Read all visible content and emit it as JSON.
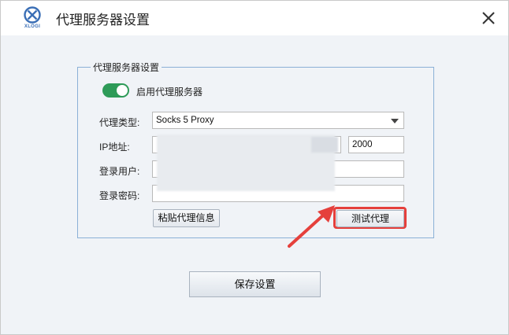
{
  "window": {
    "logo_text": "XLOGI",
    "title": "代理服务器设置",
    "close_icon": "close-icon"
  },
  "proxy_group": {
    "legend": "代理服务器设置",
    "enable_label": "启用代理服务器",
    "enabled": true,
    "type_label": "代理类型:",
    "type_value": "Socks 5 Proxy",
    "ip_label": "IP地址:",
    "ip_value": "",
    "port_value": "2000",
    "user_label": "登录用户:",
    "user_value": "",
    "password_label": "登录密码:",
    "password_value": "",
    "paste_button": "粘贴代理信息",
    "test_button": "测试代理"
  },
  "save_button": "保存设置",
  "colors": {
    "toggle_on": "#2e9b58",
    "highlight": "#e5403c",
    "group_border": "#8bb0d6"
  }
}
